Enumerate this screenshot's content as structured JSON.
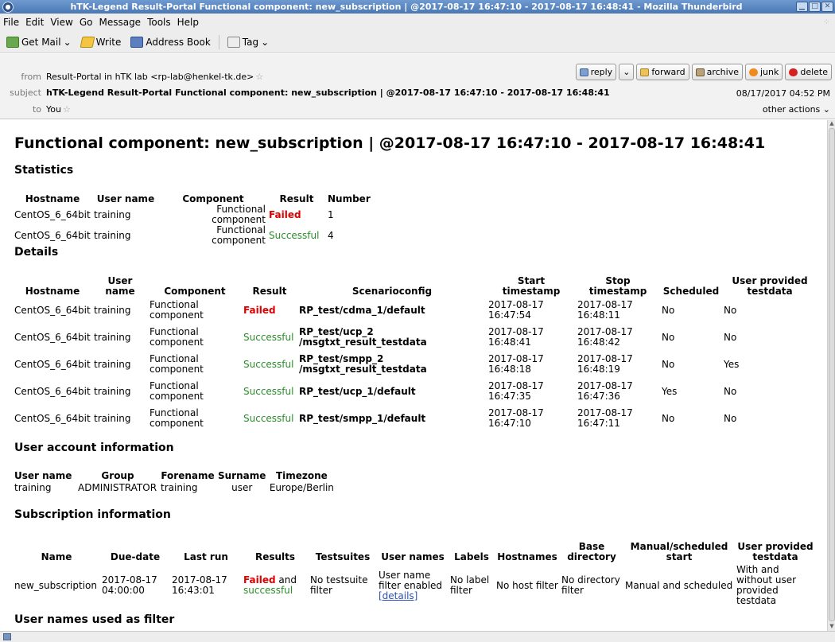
{
  "window": {
    "title": "hTK-Legend Result-Portal Functional component: new_subscription | @2017-08-17 16:47:10 - 2017-08-17 16:48:41 - Mozilla Thunderbird"
  },
  "menu": [
    "File",
    "Edit",
    "View",
    "Go",
    "Message",
    "Tools",
    "Help"
  ],
  "toolbar": {
    "get_mail": "Get Mail",
    "write": "Write",
    "address_book": "Address Book",
    "tag": "Tag"
  },
  "header": {
    "from_label": "from",
    "from_value": "Result-Portal in hTK lab <rp-lab@henkel-tk.de>",
    "subject_label": "subject",
    "subject_value": "hTK-Legend Result-Portal Functional component: new_subscription | @2017-08-17 16:47:10 - 2017-08-17 16:48:41",
    "to_label": "to",
    "to_value": "You",
    "date": "08/17/2017 04:52 PM",
    "other_actions": "other actions",
    "buttons": {
      "reply": "reply",
      "forward": "forward",
      "archive": "archive",
      "junk": "junk",
      "delete": "delete"
    }
  },
  "body": {
    "title": "Functional component: new_subscription | @2017-08-17 16:47:10 - 2017-08-17 16:48:41",
    "statistics": {
      "heading": "Statistics",
      "columns": [
        "Hostname",
        "User name",
        "Component",
        "Result",
        "Number"
      ],
      "rows": [
        [
          "CentOS_6_64bit",
          "training",
          "Functional component",
          "Failed",
          "1"
        ],
        [
          "CentOS_6_64bit",
          "training",
          "Functional component",
          "Successful",
          "4"
        ]
      ]
    },
    "details": {
      "heading": "Details",
      "columns": [
        "Hostname",
        "User name",
        "Component",
        "Result",
        "Scenarioconfig",
        "Start timestamp",
        "Stop timestamp",
        "Scheduled",
        "User provided testdata"
      ],
      "rows": [
        [
          "CentOS_6_64bit",
          "training",
          "Functional component",
          "Failed",
          "RP_test/cdma_1/default",
          "2017-08-17 16:47:54",
          "2017-08-17 16:48:11",
          "No",
          "No"
        ],
        [
          "CentOS_6_64bit",
          "training",
          "Functional component",
          "Successful",
          "RP_test/ucp_2 /msgtxt_result_testdata",
          "2017-08-17 16:48:41",
          "2017-08-17 16:48:42",
          "No",
          "No"
        ],
        [
          "CentOS_6_64bit",
          "training",
          "Functional component",
          "Successful",
          "RP_test/smpp_2 /msgtxt_result_testdata",
          "2017-08-17 16:48:18",
          "2017-08-17 16:48:19",
          "No",
          "Yes"
        ],
        [
          "CentOS_6_64bit",
          "training",
          "Functional component",
          "Successful",
          "RP_test/ucp_1/default",
          "2017-08-17 16:47:35",
          "2017-08-17 16:47:36",
          "Yes",
          "No"
        ],
        [
          "CentOS_6_64bit",
          "training",
          "Functional component",
          "Successful",
          "RP_test/smpp_1/default",
          "2017-08-17 16:47:10",
          "2017-08-17 16:47:11",
          "No",
          "No"
        ]
      ]
    },
    "user_account": {
      "heading": "User account information",
      "columns": [
        "User name",
        "Group",
        "Forename",
        "Surname",
        "Timezone"
      ],
      "row": [
        "training",
        "ADMINISTRATOR",
        "training",
        "user",
        "Europe/Berlin"
      ]
    },
    "subscription": {
      "heading": "Subscription information",
      "columns": [
        "Name",
        "Due-date",
        "Last run",
        "Results",
        "Testsuites",
        "User names",
        "Labels",
        "Hostnames",
        "Base directory",
        "Manual/scheduled start",
        "User provided testdata"
      ],
      "row": {
        "name": "new_subscription",
        "due_date": "2017-08-17 04:00:00",
        "last_run": "2017-08-17 16:43:01",
        "results_failed": "Failed",
        "results_and": "and",
        "results_successful": "successful",
        "testsuites": "No testsuite filter",
        "user_names": "User name filter enabled",
        "details_link": "[details]",
        "labels": "No label filter",
        "hostnames": "No host filter",
        "base_directory": "No directory filter",
        "start": "Manual and scheduled",
        "testdata": "With and without user provided testdata"
      }
    },
    "user_names_filter_heading": "User names used as filter"
  },
  "colors": {
    "failed": "#e00000",
    "successful": "#2a8c2a",
    "link": "#2b52b5",
    "titlebar": "#4a78b4"
  }
}
